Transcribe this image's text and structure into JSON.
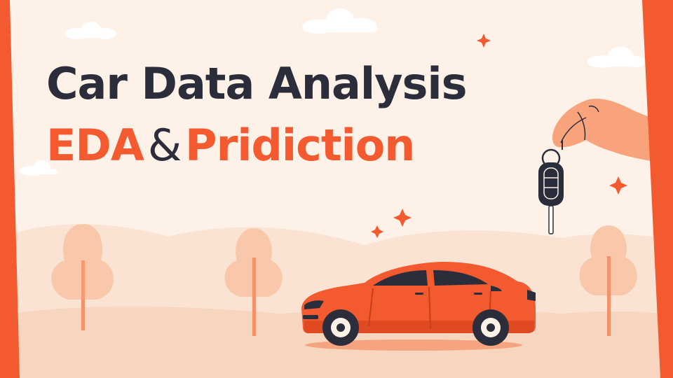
{
  "colors": {
    "background": "#fdf1e8",
    "accent": "#f45a2f",
    "dark": "#2b2e3a",
    "tree": "#f9c8aa",
    "ground": "#f6cdb2"
  },
  "headline": {
    "title": "Car Data Analysis",
    "subtitle_part1": "EDA",
    "subtitle_amp": "&",
    "subtitle_part2": "Pridiction"
  },
  "illustration": {
    "icons": [
      "car-icon",
      "car-key-icon",
      "hand-icon",
      "tree-icon",
      "cloud-icon",
      "sparkle-icon"
    ]
  }
}
